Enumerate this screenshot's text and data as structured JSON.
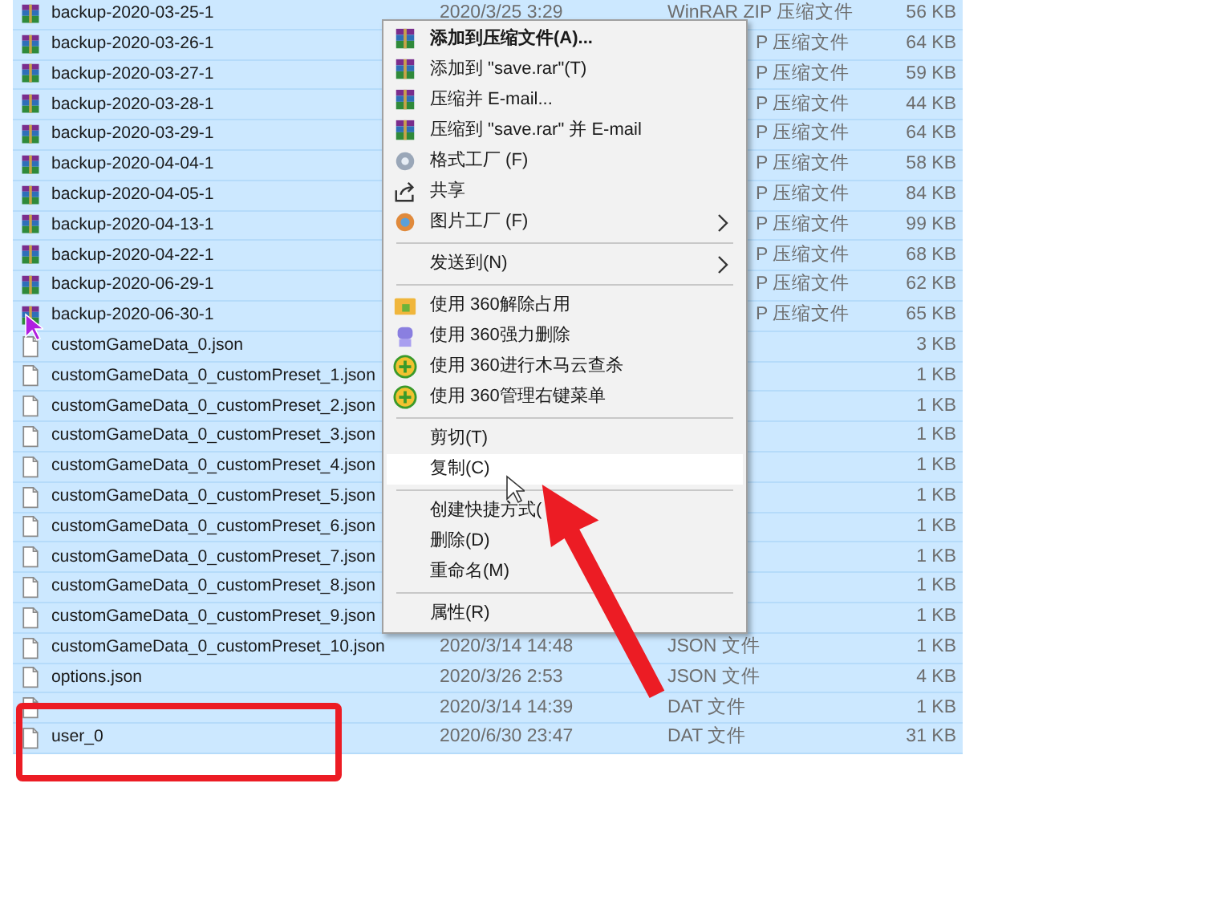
{
  "files": [
    {
      "name": "backup-2020-03-25-1",
      "kind": "archive",
      "date": "2020/3/25 3:29",
      "type": "WinRAR ZIP 压缩文件",
      "size": "56 KB",
      "selected": true
    },
    {
      "name": "backup-2020-03-26-1",
      "kind": "archive",
      "type": "P 压缩文件",
      "size": "64 KB",
      "selected": true
    },
    {
      "name": "backup-2020-03-27-1",
      "kind": "archive",
      "type": "P 压缩文件",
      "size": "59 KB",
      "selected": true
    },
    {
      "name": "backup-2020-03-28-1",
      "kind": "archive",
      "type": "P 压缩文件",
      "size": "44 KB",
      "selected": true
    },
    {
      "name": "backup-2020-03-29-1",
      "kind": "archive",
      "type": "P 压缩文件",
      "size": "64 KB",
      "selected": true
    },
    {
      "name": "backup-2020-04-04-1",
      "kind": "archive",
      "type": "P 压缩文件",
      "size": "58 KB",
      "selected": true
    },
    {
      "name": "backup-2020-04-05-1",
      "kind": "archive",
      "type": "P 压缩文件",
      "size": "84 KB",
      "selected": true
    },
    {
      "name": "backup-2020-04-13-1",
      "kind": "archive",
      "type": "P 压缩文件",
      "size": "99 KB",
      "selected": true
    },
    {
      "name": "backup-2020-04-22-1",
      "kind": "archive",
      "type": "P 压缩文件",
      "size": "68 KB",
      "selected": true
    },
    {
      "name": "backup-2020-06-29-1",
      "kind": "archive",
      "type": "P 压缩文件",
      "size": "62 KB",
      "selected": true
    },
    {
      "name": "backup-2020-06-30-1",
      "kind": "archive",
      "type": "P 压缩文件",
      "size": "65 KB",
      "selected": true
    },
    {
      "name": "customGameData_0.json",
      "kind": "document",
      "size": "3 KB",
      "selected": true
    },
    {
      "name": "customGameData_0_customPreset_1.json",
      "kind": "document",
      "size": "1 KB",
      "selected": true
    },
    {
      "name": "customGameData_0_customPreset_2.json",
      "kind": "document",
      "size": "1 KB",
      "selected": true
    },
    {
      "name": "customGameData_0_customPreset_3.json",
      "kind": "document",
      "size": "1 KB",
      "selected": true
    },
    {
      "name": "customGameData_0_customPreset_4.json",
      "kind": "document",
      "size": "1 KB",
      "selected": true
    },
    {
      "name": "customGameData_0_customPreset_5.json",
      "kind": "document",
      "size": "1 KB",
      "selected": true
    },
    {
      "name": "customGameData_0_customPreset_6.json",
      "kind": "document",
      "size": "1 KB",
      "selected": true
    },
    {
      "name": "customGameData_0_customPreset_7.json",
      "kind": "document",
      "size": "1 KB",
      "selected": true
    },
    {
      "name": "customGameData_0_customPreset_8.json",
      "kind": "document",
      "size": "1 KB",
      "selected": true
    },
    {
      "name": "customGameData_0_customPreset_9.json",
      "kind": "document",
      "size": "1 KB",
      "selected": true
    },
    {
      "name": "customGameData_0_customPreset_10.json",
      "kind": "document",
      "date": "2020/3/14 14:48",
      "type": "JSON 文件",
      "size": "1 KB",
      "selected": true
    },
    {
      "name": "options.json",
      "kind": "document",
      "date": "2020/3/26 2:53",
      "type": "JSON 文件",
      "size": "4 KB",
      "selected": true
    },
    {
      "kind": "document",
      "date": "2020/3/14 14:39",
      "type": "DAT 文件",
      "size": "1 KB",
      "selected": true
    },
    {
      "name": "user_0",
      "kind": "document",
      "date": "2020/6/30 23:47",
      "type": "DAT 文件",
      "size": "31 KB",
      "selected": true
    }
  ],
  "context_menu": [
    {
      "kind": "archive",
      "label": "添加到压缩文件(A)...",
      "bold": true,
      "submenu": false,
      "selected": false
    },
    {
      "kind": "archive",
      "label": "添加到 \"save.rar\"(T)",
      "bold": false,
      "submenu": false,
      "selected": false
    },
    {
      "kind": "archive",
      "label": "压缩并 E-mail...",
      "bold": false,
      "submenu": false,
      "selected": false
    },
    {
      "kind": "archive",
      "label": "压缩到 \"save.rar\" 并 E-mail",
      "bold": false,
      "submenu": false,
      "selected": false
    },
    {
      "kind": "gear",
      "label": "格式工厂 (F)",
      "bold": false,
      "submenu": false,
      "selected": false
    },
    {
      "kind": "share",
      "label": "共享",
      "bold": false,
      "submenu": false,
      "selected": false
    },
    {
      "kind": "flower",
      "label": "图片工厂 (F)",
      "bold": false,
      "submenu": true,
      "selected": false
    },
    {
      "kind": "separator"
    },
    {
      "kind": "plain",
      "label": "发送到(N)",
      "bold": false,
      "submenu": true,
      "selected": false
    },
    {
      "kind": "separator"
    },
    {
      "kind": "folder",
      "label": "使用 360解除占用",
      "bold": false,
      "submenu": false,
      "selected": false
    },
    {
      "kind": "robot",
      "label": "使用 360强力删除",
      "bold": false,
      "submenu": false,
      "selected": false
    },
    {
      "kind": "plus",
      "label": "使用 360进行木马云查杀",
      "bold": false,
      "submenu": false,
      "selected": false
    },
    {
      "kind": "plus",
      "label": "使用 360管理右键菜单",
      "bold": false,
      "submenu": false,
      "selected": false
    },
    {
      "kind": "separator"
    },
    {
      "kind": "plain",
      "label": "剪切(T)",
      "bold": false,
      "submenu": false,
      "selected": false
    },
    {
      "kind": "plain",
      "label": "复制(C)",
      "bold": false,
      "submenu": false,
      "selected": true
    },
    {
      "kind": "separator"
    },
    {
      "kind": "plain",
      "label": "创建快捷方式(",
      "bold": false,
      "submenu": false,
      "selected": false
    },
    {
      "kind": "plain",
      "label": "删除(D)",
      "bold": false,
      "submenu": false,
      "selected": false
    },
    {
      "kind": "plain",
      "label": "重命名(M)",
      "bold": false,
      "submenu": false,
      "selected": false
    },
    {
      "kind": "separator"
    },
    {
      "kind": "plain",
      "label": "属性(R)",
      "bold": false,
      "submenu": false,
      "selected": false
    }
  ],
  "annotations": {
    "highlight_box": true,
    "arrow": true
  },
  "cursors": {
    "on_file": true,
    "on_menu": true
  }
}
